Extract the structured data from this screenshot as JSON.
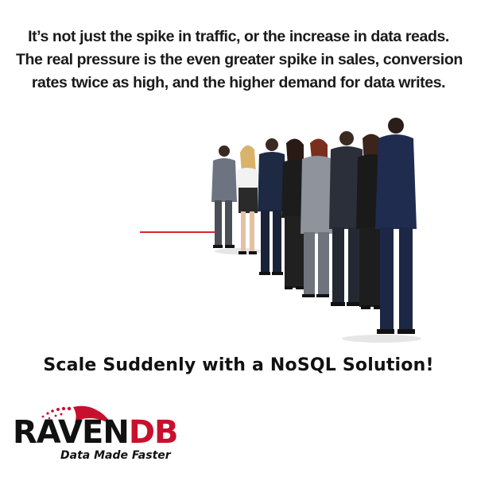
{
  "headline": {
    "line1": "It’s not just the spike in traffic, or the increase in data reads.",
    "line2": "The real pressure is the even greater spike in sales, conversion",
    "line3": "rates twice as high, and the higher demand for data writes."
  },
  "tagline": "Scale Suddenly with a NoSQL Solution!",
  "logo": {
    "brand_part1": "RAVEN",
    "brand_part2": "DB",
    "slogan": "Data Made Faster",
    "accent_color": "#c8102e"
  },
  "illustration": {
    "subject": "people-standing-in-line",
    "line_color": "#d8262e"
  }
}
